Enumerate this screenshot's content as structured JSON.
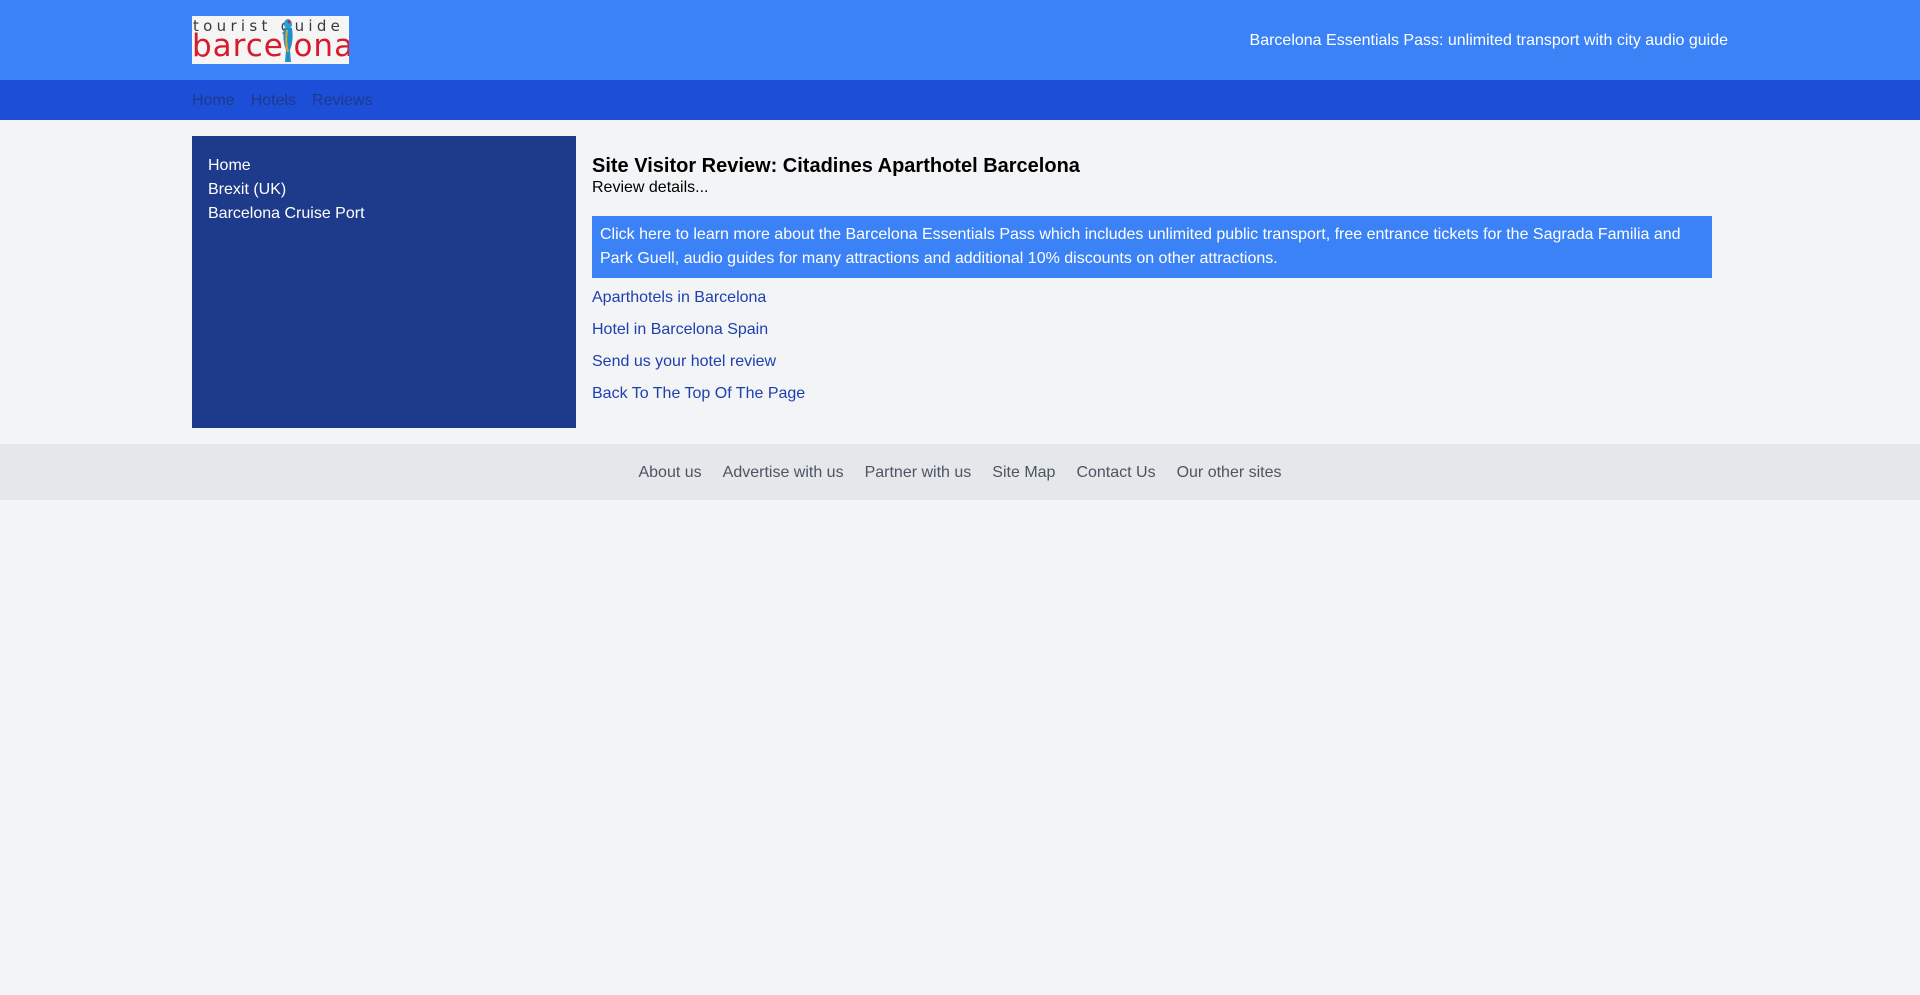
{
  "header": {
    "logo": {
      "top_text": "tourist guide",
      "bottom_text": "barcelona",
      "colors": {
        "top": "#3a3a3a",
        "bottom": "#d81b2c"
      }
    },
    "promo_link": "Barcelona Essentials Pass: unlimited transport with city audio guide",
    "background": "#3b82f6"
  },
  "navbar": {
    "items": [
      {
        "label": "Home"
      },
      {
        "label": "Hotels"
      },
      {
        "label": "Reviews"
      }
    ],
    "background": "#1d4ed8"
  },
  "sidebar": {
    "items": [
      {
        "label": "Home"
      },
      {
        "label": "Brexit (UK)"
      },
      {
        "label": "Barcelona Cruise Port"
      }
    ],
    "background": "#1e3a8a"
  },
  "main": {
    "title": "Site Visitor Review: Citadines Aparthotel Barcelona",
    "subtitle": "Review details...",
    "promo_box": "Click here to learn more about the Barcelona Essentials Pass which includes unlimited public transport, free entrance tickets for the Sagrada Familia and Park Guell, audio guides for many attractions and additional 10% discounts on other attractions.",
    "links": [
      {
        "label": "Aparthotels in Barcelona"
      },
      {
        "label": "Hotel in Barcelona Spain"
      },
      {
        "label": "Send us your hotel review"
      },
      {
        "label": "Back To The Top Of The Page"
      }
    ]
  },
  "footer": {
    "items": [
      {
        "label": "About us"
      },
      {
        "label": "Advertise with us"
      },
      {
        "label": "Partner with us"
      },
      {
        "label": "Site Map"
      },
      {
        "label": "Contact Us"
      },
      {
        "label": "Our other sites"
      }
    ]
  }
}
